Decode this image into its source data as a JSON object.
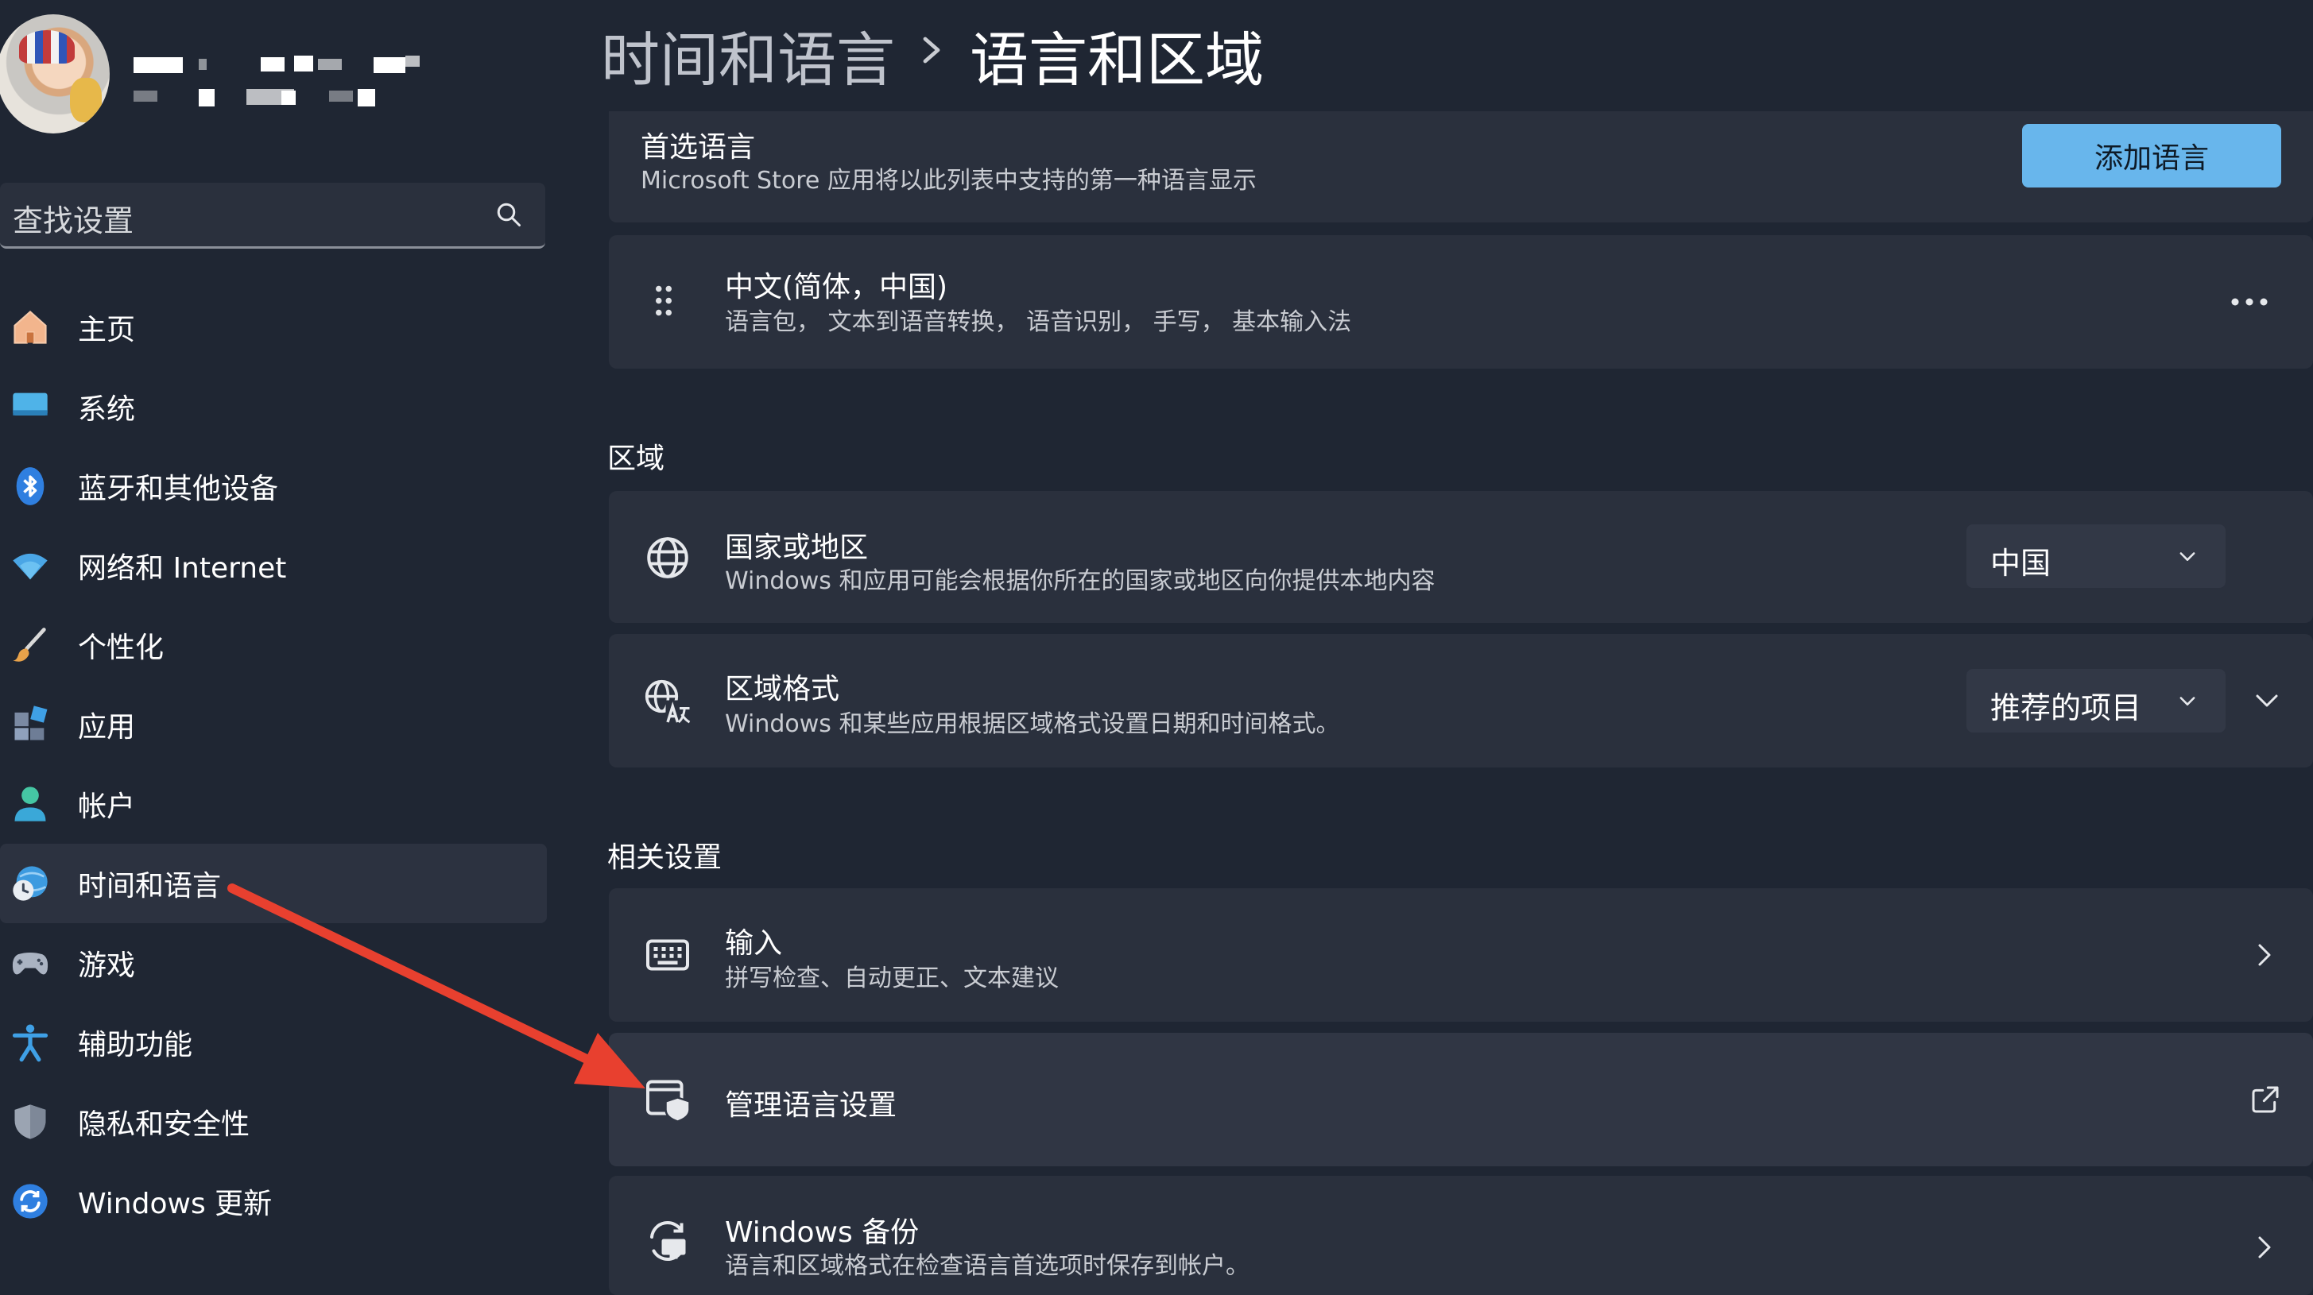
{
  "sidebar": {
    "search_placeholder": "查找设置",
    "items": [
      {
        "label": "主页",
        "icon": "home-icon"
      },
      {
        "label": "系统",
        "icon": "monitor-icon"
      },
      {
        "label": "蓝牙和其他设备",
        "icon": "bluetooth-icon"
      },
      {
        "label": "网络和 Internet",
        "icon": "wifi-icon"
      },
      {
        "label": "个性化",
        "icon": "brush-icon"
      },
      {
        "label": "应用",
        "icon": "apps-icon"
      },
      {
        "label": "帐户",
        "icon": "account-icon"
      },
      {
        "label": "时间和语言",
        "icon": "time-language-icon",
        "active": true
      },
      {
        "label": "游戏",
        "icon": "gamepad-icon"
      },
      {
        "label": "辅助功能",
        "icon": "accessibility-icon"
      },
      {
        "label": "隐私和安全性",
        "icon": "shield-icon"
      },
      {
        "label": "Windows 更新",
        "icon": "update-icon"
      }
    ]
  },
  "breadcrumb": {
    "parent": "时间和语言",
    "current": "语言和区域"
  },
  "preferred": {
    "title": "首选语言",
    "desc": "Microsoft Store 应用将以此列表中支持的第一种语言显示",
    "add_button": "添加语言"
  },
  "language_item": {
    "title": "中文(简体，中国)",
    "desc": "语言包， 文本到语音转换， 语音识别， 手写， 基本输入法"
  },
  "region": {
    "header": "区域",
    "country": {
      "title": "国家或地区",
      "desc": "Windows 和应用可能会根据你所在的国家或地区向你提供本地内容",
      "value": "中国"
    },
    "format": {
      "title": "区域格式",
      "desc": "Windows 和某些应用根据区域格式设置日期和时间格式。",
      "value": "推荐的项目"
    }
  },
  "related": {
    "header": "相关设置",
    "input": {
      "title": "输入",
      "desc": "拼写检查、自动更正、文本建议"
    },
    "manage": {
      "title": "管理语言设置"
    },
    "backup": {
      "title": "Windows 备份",
      "desc": "语言和区域格式在检查语言首选项时保存到帐户。"
    }
  },
  "colors": {
    "background": "#1f2633",
    "card": "#2a303d",
    "accent": "#68b6ec",
    "annotation_arrow": "#e8402f"
  }
}
